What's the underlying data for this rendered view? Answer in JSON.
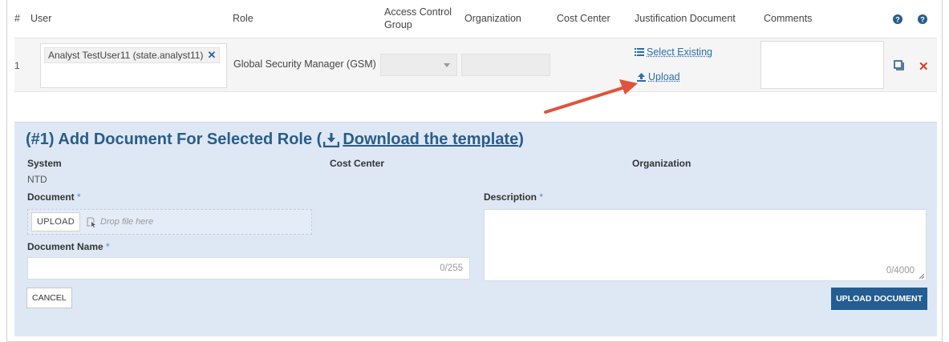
{
  "table": {
    "headers": {
      "num": "#",
      "user": "User",
      "role": "Role",
      "acg": "Access Control Group",
      "organization": "Organization",
      "cost_center": "Cost Center",
      "justification": "Justification Document",
      "comments": "Comments"
    },
    "row": {
      "number": "1",
      "user_tag": "Analyst TestUser11 (state.analyst11)",
      "role_value": "Global Security Manager (GSM)",
      "select_existing": "Select Existing",
      "upload": "Upload"
    }
  },
  "form": {
    "title_prefix": "(#1) Add Document For Selected Role (",
    "download_link": "Download the template",
    "title_suffix": ")",
    "system_label": "System",
    "system_value": "NTD",
    "cost_center_label": "Cost Center",
    "organization_label": "Organization",
    "document_label": "Document",
    "required_mark": "*",
    "upload_button": "UPLOAD",
    "drop_text": "Drop file here",
    "doc_name_label": "Document Name",
    "doc_name_counter": "0/255",
    "description_label": "Description",
    "description_counter": "0/4000",
    "cancel_button": "CANCEL",
    "upload_document_button": "UPLOAD DOCUMENT"
  },
  "colors": {
    "link": "#2a6db0",
    "panel_bg": "#dde8f4",
    "primary_button": "#245d91",
    "remove_red": "#d9382b",
    "arrow": "#e0533c"
  }
}
